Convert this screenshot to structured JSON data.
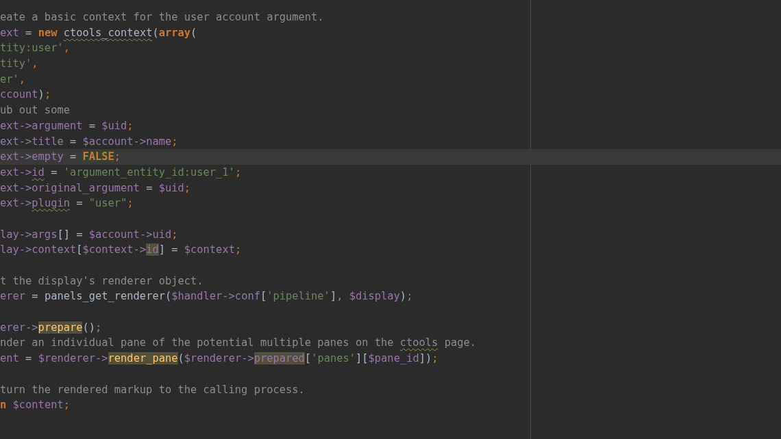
{
  "editor": {
    "lines": [
      {
        "current": false,
        "tokens": [
          {
            "kind": "comment",
            "text": "eate a basic context for the user account argument."
          }
        ]
      },
      {
        "current": false,
        "tokens": [
          {
            "kind": "var",
            "text": "ext"
          },
          {
            "kind": "plain",
            "text": " = "
          },
          {
            "kind": "keyword",
            "text": "new "
          },
          {
            "kind": "typo",
            "text": "ctools_context"
          },
          {
            "kind": "plain",
            "text": "("
          },
          {
            "kind": "keyword",
            "text": "array"
          },
          {
            "kind": "plain",
            "text": "("
          }
        ]
      },
      {
        "current": false,
        "tokens": [
          {
            "kind": "string",
            "text": "tity:user'"
          },
          {
            "kind": "punct",
            "text": ","
          }
        ]
      },
      {
        "current": false,
        "tokens": [
          {
            "kind": "string",
            "text": "tity'"
          },
          {
            "kind": "punct",
            "text": ","
          }
        ]
      },
      {
        "current": false,
        "tokens": [
          {
            "kind": "string",
            "text": "er'"
          },
          {
            "kind": "punct",
            "text": ","
          }
        ]
      },
      {
        "current": false,
        "tokens": [
          {
            "kind": "var",
            "text": "ccount"
          },
          {
            "kind": "plain",
            "text": ")"
          },
          {
            "kind": "punct",
            "text": ";"
          }
        ]
      },
      {
        "current": false,
        "tokens": [
          {
            "kind": "comment",
            "text": "ub out some"
          }
        ]
      },
      {
        "current": false,
        "tokens": [
          {
            "kind": "var",
            "text": "ext->argument"
          },
          {
            "kind": "plain",
            "text": " = "
          },
          {
            "kind": "var",
            "text": "$uid"
          },
          {
            "kind": "punct",
            "text": ";"
          }
        ]
      },
      {
        "current": false,
        "tokens": [
          {
            "kind": "var",
            "text": "ext->title"
          },
          {
            "kind": "plain",
            "text": " = "
          },
          {
            "kind": "var",
            "text": "$account->name"
          },
          {
            "kind": "punct",
            "text": ";"
          }
        ]
      },
      {
        "current": true,
        "tokens": [
          {
            "kind": "var",
            "text": "ext->empty"
          },
          {
            "kind": "plain",
            "text": " = "
          },
          {
            "kind": "const-hit",
            "text": "FALSE"
          },
          {
            "kind": "punct",
            "text": ";"
          }
        ]
      },
      {
        "current": false,
        "tokens": [
          {
            "kind": "var",
            "text": "ext->"
          },
          {
            "kind": "field-typo",
            "text": "id"
          },
          {
            "kind": "plain",
            "text": " = "
          },
          {
            "kind": "string",
            "text": "'argument_entity_id:user_1'"
          },
          {
            "kind": "punct",
            "text": ";"
          }
        ]
      },
      {
        "current": false,
        "tokens": [
          {
            "kind": "var",
            "text": "ext->original_argument"
          },
          {
            "kind": "plain",
            "text": " = "
          },
          {
            "kind": "var",
            "text": "$uid"
          },
          {
            "kind": "punct",
            "text": ";"
          }
        ]
      },
      {
        "current": false,
        "tokens": [
          {
            "kind": "var",
            "text": "ext->"
          },
          {
            "kind": "field-typo",
            "text": "plugin"
          },
          {
            "kind": "plain",
            "text": " = "
          },
          {
            "kind": "string",
            "text": "\"user\""
          },
          {
            "kind": "punct",
            "text": ";"
          }
        ]
      },
      {
        "current": false
      },
      {
        "current": false,
        "tokens": [
          {
            "kind": "var",
            "text": "lay->args"
          },
          {
            "kind": "plain",
            "text": "[] = "
          },
          {
            "kind": "var",
            "text": "$account->uid"
          },
          {
            "kind": "punct",
            "text": ";"
          }
        ]
      },
      {
        "current": false,
        "tokens": [
          {
            "kind": "var",
            "text": "lay->context"
          },
          {
            "kind": "plain",
            "text": "["
          },
          {
            "kind": "var",
            "text": "$context->"
          },
          {
            "kind": "field-hit",
            "text": "id"
          },
          {
            "kind": "plain",
            "text": "] = "
          },
          {
            "kind": "var",
            "text": "$context"
          },
          {
            "kind": "punct",
            "text": ";"
          }
        ]
      },
      {
        "current": false
      },
      {
        "current": false,
        "tokens": [
          {
            "kind": "comment",
            "text": "t the display's renderer object."
          }
        ]
      },
      {
        "current": false,
        "tokens": [
          {
            "kind": "var",
            "text": "erer"
          },
          {
            "kind": "plain",
            "text": " = panels_get_renderer("
          },
          {
            "kind": "var",
            "text": "$handler->conf"
          },
          {
            "kind": "plain",
            "text": "["
          },
          {
            "kind": "string",
            "text": "'pipeline'"
          },
          {
            "kind": "plain",
            "text": "]"
          },
          {
            "kind": "punct",
            "text": ", "
          },
          {
            "kind": "var",
            "text": "$display"
          },
          {
            "kind": "plain",
            "text": ")"
          },
          {
            "kind": "punct",
            "text": ";"
          }
        ]
      },
      {
        "current": false
      },
      {
        "current": false,
        "tokens": [
          {
            "kind": "var",
            "text": "erer->"
          },
          {
            "kind": "method-hit",
            "text": "prepare"
          },
          {
            "kind": "plain",
            "text": "()"
          },
          {
            "kind": "punct",
            "text": ";"
          }
        ]
      },
      {
        "current": false,
        "tokens": [
          {
            "kind": "comment",
            "text": "nder an individual pane of the potential multiple panes on the "
          },
          {
            "kind": "comment-typo",
            "text": "ctools"
          },
          {
            "kind": "comment",
            "text": " page."
          }
        ]
      },
      {
        "current": false,
        "tokens": [
          {
            "kind": "var",
            "text": "ent"
          },
          {
            "kind": "plain",
            "text": " = "
          },
          {
            "kind": "var",
            "text": "$renderer->"
          },
          {
            "kind": "method-hit",
            "text": "render_pane"
          },
          {
            "kind": "plain",
            "text": "("
          },
          {
            "kind": "var",
            "text": "$renderer->"
          },
          {
            "kind": "field-hit",
            "text": "prepared"
          },
          {
            "kind": "plain",
            "text": "["
          },
          {
            "kind": "string",
            "text": "'panes'"
          },
          {
            "kind": "plain",
            "text": "]["
          },
          {
            "kind": "var",
            "text": "$pane_id"
          },
          {
            "kind": "plain",
            "text": "])"
          },
          {
            "kind": "punct",
            "text": ";"
          }
        ]
      },
      {
        "current": false
      },
      {
        "current": false,
        "tokens": [
          {
            "kind": "comment",
            "text": "turn the rendered markup to the calling process."
          }
        ]
      },
      {
        "current": false,
        "tokens": [
          {
            "kind": "keyword",
            "text": "n "
          },
          {
            "kind": "var",
            "text": "$content"
          },
          {
            "kind": "punct",
            "text": ";"
          }
        ]
      }
    ]
  }
}
